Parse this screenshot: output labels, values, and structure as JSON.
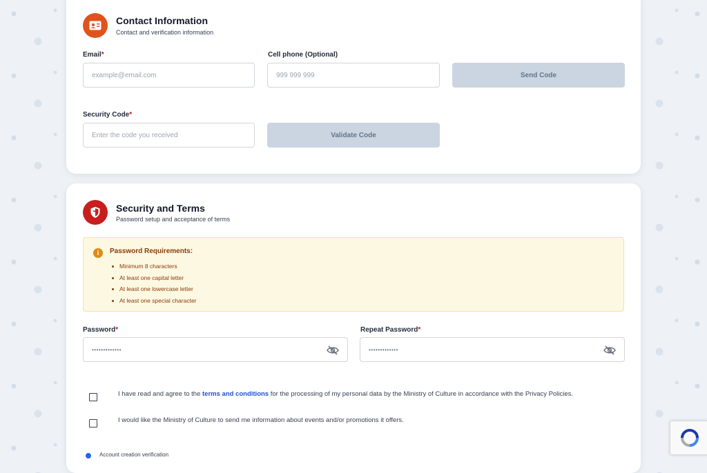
{
  "contact": {
    "title": "Contact Information",
    "subtitle": "Contact and verification information",
    "email_label": "Email",
    "email_placeholder": "example@email.com",
    "phone_label": "Cell phone (Optional)",
    "phone_placeholder": "999 999 999",
    "send_code_label": "Send Code",
    "security_code_label": "Security Code",
    "security_code_placeholder": "Enter the code you received",
    "validate_code_label": "Validate Code",
    "required_mark": "*",
    "icon": "id-card-icon"
  },
  "security": {
    "title": "Security and Terms",
    "subtitle": "Password setup and acceptance of terms",
    "icon": "shield-icon",
    "requirements_title": "Password Requirements:",
    "requirements": [
      "Minimum 8 characters",
      "At least one capital letter",
      "At least one lowercase letter",
      "At least one special character"
    ],
    "password_label": "Password",
    "password_value": "•••••••••••••",
    "repeat_password_label": "Repeat Password",
    "repeat_password_value": "•••••••••••••",
    "terms_before": "I have read and agree to the ",
    "terms_link": "terms and conditions",
    "terms_after": " for the processing of my personal data by the Ministry of Culture in accordance with the Privacy Policies.",
    "promotions_text": "I would like the Ministry of Culture to send me information about events and/or promotions it offers.",
    "verification_text": "Account creation verification"
  },
  "colors": {
    "contact_icon_bg": "#e0531c",
    "security_icon_bg": "#c81e1e",
    "notice_bg": "#fdf8e1",
    "notice_text": "#8a3a0b",
    "disabled_button": "#cbd5e1",
    "link": "#1d4ed8"
  }
}
